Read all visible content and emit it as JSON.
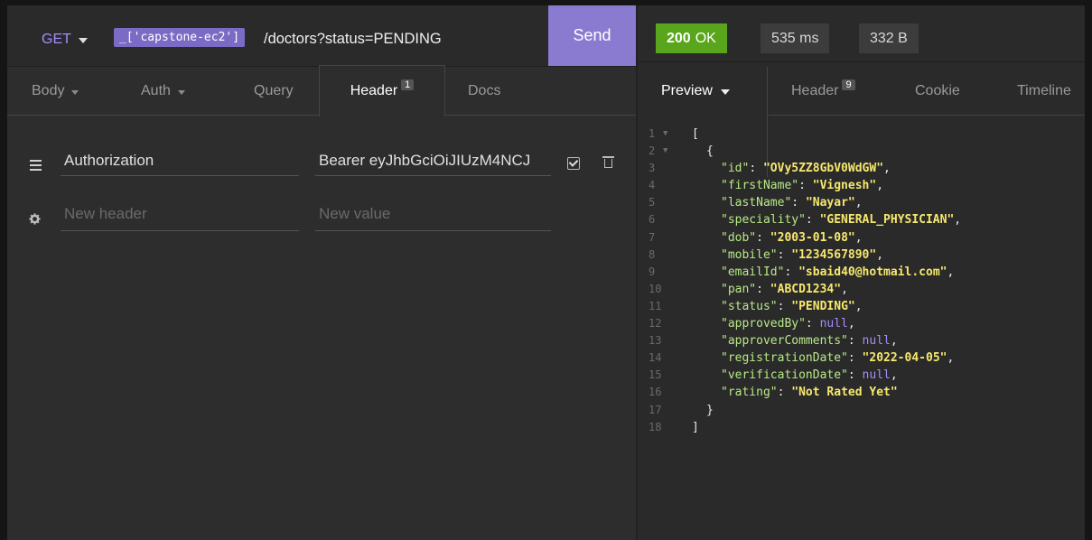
{
  "request": {
    "method": "GET",
    "env_tag": "_['capstone-ec2']",
    "url_path": "/doctors?status=PENDING",
    "send_label": "Send"
  },
  "request_tabs": [
    {
      "label": "Body"
    },
    {
      "label": "Auth"
    },
    {
      "label": "Query"
    },
    {
      "label": "Header",
      "badge": "1"
    },
    {
      "label": "Docs"
    }
  ],
  "headers": [
    {
      "name": "Authorization",
      "value": "Bearer eyJhbGciOiJIUzM4NCJ"
    }
  ],
  "new_header": {
    "name_placeholder": "New header",
    "value_placeholder": "New value"
  },
  "response": {
    "status_code": "200",
    "status_text": "OK",
    "time": "535 ms",
    "size": "332 B"
  },
  "response_tabs": [
    {
      "label": "Preview"
    },
    {
      "label": "Header",
      "badge": "9"
    },
    {
      "label": "Cookie"
    },
    {
      "label": "Timeline"
    }
  ],
  "colors": {
    "accent": "#8a7bd0",
    "ok": "#59a61c",
    "json_key": "#b8e986",
    "json_string": "#f7e86d",
    "json_null": "#a78bfa"
  },
  "response_body": [
    {
      "key": "id",
      "value": "OVy5ZZ8GbV0WdGW",
      "type": "string"
    },
    {
      "key": "firstName",
      "value": "Vignesh",
      "type": "string"
    },
    {
      "key": "lastName",
      "value": "Nayar",
      "type": "string"
    },
    {
      "key": "speciality",
      "value": "GENERAL_PHYSICIAN",
      "type": "string"
    },
    {
      "key": "dob",
      "value": "2003-01-08",
      "type": "string"
    },
    {
      "key": "mobile",
      "value": "1234567890",
      "type": "string"
    },
    {
      "key": "emailId",
      "value": "sbaid40@hotmail.com",
      "type": "string"
    },
    {
      "key": "pan",
      "value": "ABCD1234",
      "type": "string"
    },
    {
      "key": "status",
      "value": "PENDING",
      "type": "string"
    },
    {
      "key": "approvedBy",
      "value": "null",
      "type": "null"
    },
    {
      "key": "approverComments",
      "value": "null",
      "type": "null"
    },
    {
      "key": "registrationDate",
      "value": "2022-04-05",
      "type": "string"
    },
    {
      "key": "verificationDate",
      "value": "null",
      "type": "null"
    },
    {
      "key": "rating",
      "value": "Not Rated Yet",
      "type": "string"
    }
  ],
  "brackets": {
    "open_array": "[",
    "open_object": "{",
    "close_object": "}",
    "close_array": "]"
  },
  "icons": {
    "method_caret": "chevron-down-icon",
    "header_row": "hamburger-icon",
    "new_header_row": "gear-icon",
    "enable": "checkbox-icon",
    "delete": "trash-icon"
  }
}
